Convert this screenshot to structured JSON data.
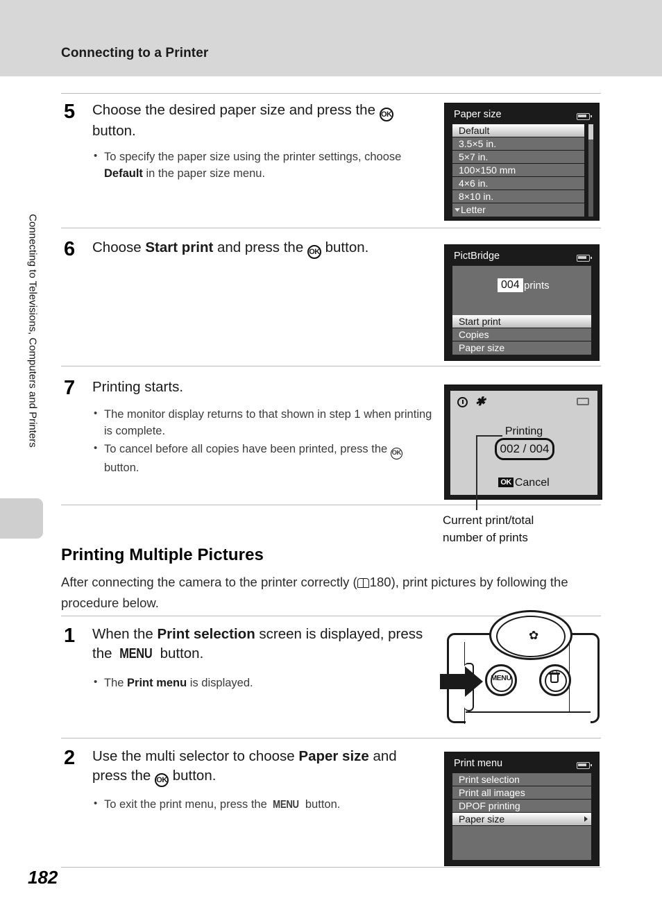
{
  "header": {
    "running_title": "Connecting to a Printer"
  },
  "side_tab": {
    "label": "Connecting to Televisions, Computers and Printers"
  },
  "page_number": "182",
  "steps": [
    {
      "number": "5",
      "text_before": "Choose the desired paper size and press the ",
      "icon": "ok-button-icon",
      "text_after": " button.",
      "bullets": [
        {
          "pre": "To specify the paper size using the printer settings, choose ",
          "strong": "Default",
          "post": " in the paper size menu."
        }
      ]
    },
    {
      "number": "6",
      "text_before": "Choose ",
      "strong": "Start print",
      "text_mid": " and press the ",
      "icon": "ok-button-icon",
      "text_after": " button.",
      "bullets": []
    },
    {
      "number": "7",
      "title": "Printing starts.",
      "bullets": [
        {
          "pre": "The monitor display returns to that shown in step 1 when printing is complete."
        },
        {
          "pre": "To cancel before all copies have been printed, press the ",
          "icon": "ok-button-icon",
          "post": " button."
        }
      ]
    }
  ],
  "section": {
    "heading": "Printing Multiple Pictures",
    "intro_before": "After connecting the camera to the printer correctly (",
    "intro_ref_icon": "book-icon",
    "intro_ref": "180",
    "intro_after": "), print pictures by following the procedure below."
  },
  "section_steps": [
    {
      "number": "1",
      "t1": "When the ",
      "strong": "Print selection",
      "t2": " screen is displayed, press the ",
      "menu": "MENU",
      "t3": " button.",
      "bullets": [
        {
          "pre": "The ",
          "strong": "Print menu",
          "post": " is displayed."
        }
      ]
    },
    {
      "number": "2",
      "t1": "Use the multi selector to choose ",
      "strong": "Paper size",
      "t2": " and press the ",
      "icon": "ok-button-icon",
      "t3": " button.",
      "bullets": [
        {
          "pre": "To exit the print menu, press the ",
          "menu": "MENU",
          "post": " button."
        }
      ]
    }
  ],
  "screens": {
    "paper_size": {
      "title": "Paper size",
      "battery_icon": "battery-icon",
      "items": [
        {
          "label": "Default",
          "selected": true
        },
        {
          "label": "3.5×5 in.",
          "selected": false
        },
        {
          "label": "5×7 in.",
          "selected": false
        },
        {
          "label": "100×150 mm",
          "selected": false
        },
        {
          "label": "4×6 in.",
          "selected": false
        },
        {
          "label": "8×10 in.",
          "selected": false
        },
        {
          "label": "Letter",
          "selected": false,
          "caret": "caret-down-icon"
        }
      ]
    },
    "pictbridge": {
      "title": "PictBridge",
      "battery_icon": "battery-icon",
      "count": "004",
      "count_label": "prints",
      "items": [
        {
          "label": "Start print",
          "selected": true
        },
        {
          "label": "Copies",
          "selected": false
        },
        {
          "label": "Paper size",
          "selected": false
        }
      ]
    },
    "printing": {
      "status_icons": [
        "clock-icon",
        "camera-shake-icon"
      ],
      "battery_icon": "battery-icon",
      "label": "Printing",
      "progress": "002 / 004",
      "cancel_badge": "OK",
      "cancel_label": "Cancel",
      "callout_line1": "Current print/total",
      "callout_line2": "number of prints"
    },
    "print_menu": {
      "title": "Print menu",
      "battery_icon": "battery-icon",
      "items": [
        {
          "label": "Print selection",
          "selected": false
        },
        {
          "label": "Print all images",
          "selected": false
        },
        {
          "label": "DPOF printing",
          "selected": false
        },
        {
          "label": "Paper size",
          "selected": true,
          "caret": "caret-right-icon"
        }
      ]
    }
  },
  "camera_illustration": {
    "menu_button_label": "MENU",
    "delete_button_icon": "trash-icon",
    "macro_icon": "macro-flower-icon",
    "pointer_icon": "arrow-right-icon"
  },
  "colors": {
    "header_band": "#d7d7d7",
    "lcd_bg": "#1c1b1b",
    "lcd_row": "#6e6e6e",
    "selected_row": "#ffffff",
    "printing_bg": "#cfcfcf"
  }
}
